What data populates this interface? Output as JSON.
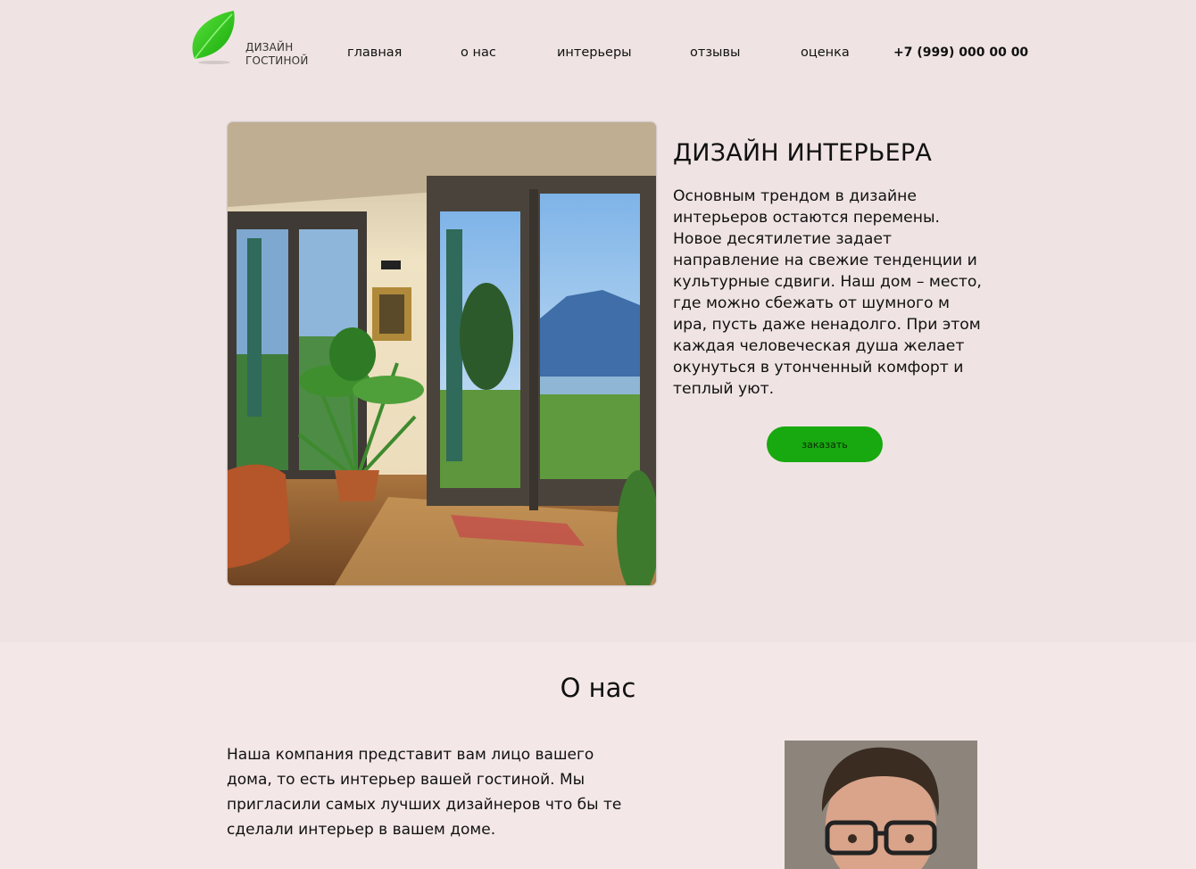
{
  "header": {
    "logo": {
      "line1": "ДИЗАЙН",
      "line2": "ГОСТИНОЙ",
      "icon": "leaf-icon",
      "color": "#2fc71a"
    },
    "nav": [
      {
        "label": "главная"
      },
      {
        "label": "о нас"
      },
      {
        "label": "интерьеры"
      },
      {
        "label": "отзывы"
      },
      {
        "label": "оценка"
      }
    ],
    "phone": "+7 (999) 000 00 00"
  },
  "hero": {
    "title": "ДИЗАЙН ИНТЕРЬЕРА",
    "text": "Основным трендом в дизайне интерьеров остаются перемены. Новое десятилетие задает направление на свежие тенденции и культурные сдвиги. Наш дом – место, где можно сбежать от шумного м ира, пусть даже ненадолго. При этом каждая человеческая душа желает окунуться в утонченный комфорт и теплый уют.",
    "button_label": "заказать",
    "button_color": "#17a90f",
    "image": "living-room-interior-photo"
  },
  "about": {
    "title": "О нас",
    "text": "Наша компания представит вам лицо вашего дома, то есть интерьер вашей гостиной. Мы пригласили самых лучших дизайнеров что бы те сделали интерьер в вашем доме.",
    "image": "designer-portrait-photo"
  },
  "colors": {
    "background": "#efe4e3",
    "section_background": "#f3e7e7",
    "accent": "#17a90f"
  }
}
